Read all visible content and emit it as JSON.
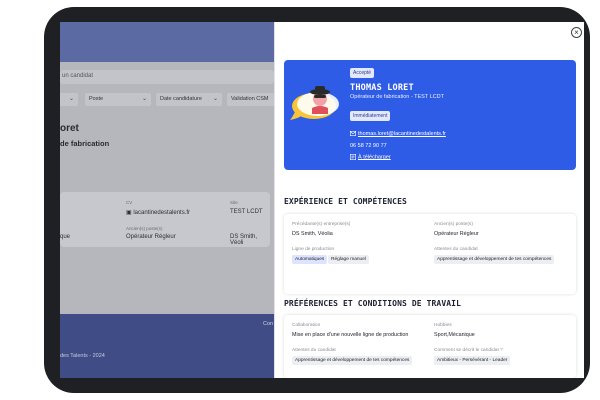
{
  "background_app": {
    "search_placeholder": "un candidat",
    "filters": [
      "",
      "Poste",
      "Date candidature",
      "Validation CSM"
    ],
    "candidate_name": "oret",
    "candidate_job": "de fabrication",
    "card": {
      "label_cv": "CV",
      "value_cv": "lacantinedestalents.fr",
      "label_site": "Site",
      "value_site": "TEST LCDT",
      "value_left": "que",
      "label_prev_pos": "Ancien(s) poste(s)",
      "value_prev_pos": "Opérateur Régleur",
      "value_prev_co": "DS Smith, Véoli"
    },
    "footer_link": "Con",
    "copyright": "des Talents - 2024"
  },
  "drawer": {
    "close_icon": "close-icon",
    "profile": {
      "status_badge": "Accepté",
      "name": "THOMAS LORET",
      "subtitle": "Opérateur de fabrication - TEST LCDT",
      "availability_badge": "Immédiatement",
      "email": "thomas.loret@lacantinedestalents.fr",
      "phone": "06 58 72 90 77",
      "download_label": "À télécharger",
      "colors": {
        "card_bg": "#2f5ce6"
      }
    },
    "experience": {
      "title": "EXPÉRIENCE ET COMPÉTENCES",
      "prev_company_label": "Précédante(s) entreprise(s)",
      "prev_company_value": "DS Smith, Véolia",
      "prev_position_label": "Ancien(s) poste(s)",
      "prev_position_value": "Opérateur Régleur",
      "production_line_label": "Ligne de production",
      "production_line_tags": [
        "Automatiques",
        "Réglage manuel"
      ],
      "expectations_label": "Attentes du candidat",
      "expectations_value": "Apprentissage et développement de tes compétences"
    },
    "preferences": {
      "title": "PRÉFÉRENCES ET CONDITIONS DE TRAVAIL",
      "collaboration_label": "Collaboration",
      "collaboration_value": "Mise en place d'une nouvelle ligne de production",
      "hobbies_label": "Hobbies",
      "hobbies_value": "Sport,Mécanique",
      "expectations_label": "Attentes du candidat",
      "expectations_value": "Apprentissage et développement de tes compétences",
      "self_description_label": "Comment se décrit le candidat ?",
      "self_description_value": "Ambitieux - Persévérant - Leader"
    }
  }
}
